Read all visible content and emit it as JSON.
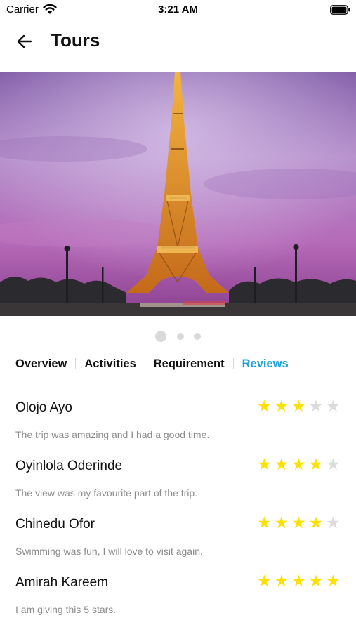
{
  "status_bar": {
    "carrier": "Carrier",
    "time": "3:21 AM"
  },
  "header": {
    "title": "Tours",
    "back_icon": "arrow-left-icon"
  },
  "hero": {
    "pager_total": 3,
    "pager_active_index": 0
  },
  "tabs": [
    {
      "label": "Overview",
      "active": false
    },
    {
      "label": "Activities",
      "active": false
    },
    {
      "label": "Requirement",
      "active": false
    },
    {
      "label": "Reviews",
      "active": true
    }
  ],
  "colors": {
    "accent": "#1aa0d8",
    "star_on": "#ffe100",
    "star_off": "#dcdcdc",
    "comment": "#8c8c8c"
  },
  "reviews": [
    {
      "name": "Olojo Ayo",
      "rating": 3,
      "max": 5,
      "comment": "The trip was amazing and I had a good time."
    },
    {
      "name": "Oyinlola Oderinde",
      "rating": 4,
      "max": 5,
      "comment": "The view was my favourite part of the trip."
    },
    {
      "name": "Chinedu Ofor",
      "rating": 4,
      "max": 5,
      "comment": "Swimming was fun, I will love to visit again."
    },
    {
      "name": "Amirah Kareem",
      "rating": 5,
      "max": 5,
      "comment": "I am giving this 5 stars."
    }
  ]
}
